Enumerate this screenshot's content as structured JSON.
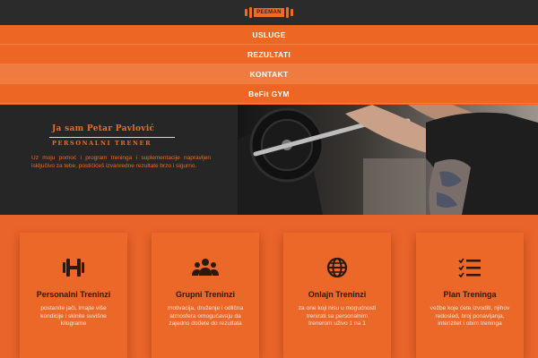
{
  "brand": {
    "logo_text": "PEEMAN"
  },
  "nav": {
    "items": [
      {
        "label": "USLUGE"
      },
      {
        "label": "REZULTATI"
      },
      {
        "label": "KONTAKT"
      },
      {
        "label": "BeFit GYM"
      }
    ]
  },
  "hero": {
    "name": "Ja sam Petar Pavlović",
    "subtitle": "PERSONALNI TRENER",
    "description": "Uz moju pomoć i program treninga i suplementacije napravljen isključivo za tebe, postićićeš izvanredne rezultate brzo i sigurno."
  },
  "services": [
    {
      "icon": "dumbbell-icon",
      "title": "Personalni Treninzi",
      "description": "postanite jači, imajte više kondicije i skinite suvišne kilograme"
    },
    {
      "icon": "group-icon",
      "title": "Grupni Treninzi",
      "description": "motivacija, druženje i odlična atmosfera omogućavaju da zajedno dođete do rezultata"
    },
    {
      "icon": "globe-icon",
      "title": "Onlajn Treninzi",
      "description": "za one koji nisu u mogućnosti trenirati sa personalnim trenerom uživo 1 na 1"
    },
    {
      "icon": "checklist-icon",
      "title": "Plan Treninga",
      "description": "vežbe koje ćete izvoditi, njihov redosled, broj ponavljanja, intenzitet i obim treninga"
    }
  ],
  "colors": {
    "accent": "#f36a21",
    "dark": "#262626",
    "icon": "#2b1a10"
  }
}
